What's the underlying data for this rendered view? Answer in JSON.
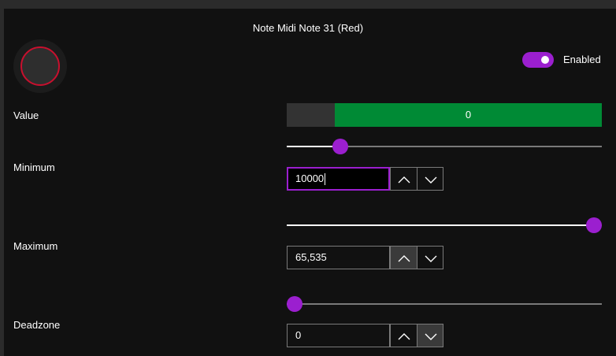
{
  "title": "Note Midi Note 31 (Red)",
  "toggle": {
    "label": "Enabled",
    "on": true,
    "accent": "#9b1fcf"
  },
  "value": {
    "label": "Value",
    "display": "0",
    "fill_fraction": 0.1525,
    "fill_color": "#008a35"
  },
  "minimum": {
    "label": "Minimum",
    "input": "10000",
    "slider_fraction": 0.17
  },
  "maximum": {
    "label": "Maximum",
    "input": "65,535",
    "slider_fraction": 0.975
  },
  "deadzone": {
    "label": "Deadzone",
    "input": "0",
    "slider_fraction": 0.025
  },
  "icons": {
    "up": "chevron-up-icon",
    "down": "chevron-down-icon"
  },
  "colors": {
    "accent": "#9b1fcf",
    "ring": "#c8102e"
  }
}
